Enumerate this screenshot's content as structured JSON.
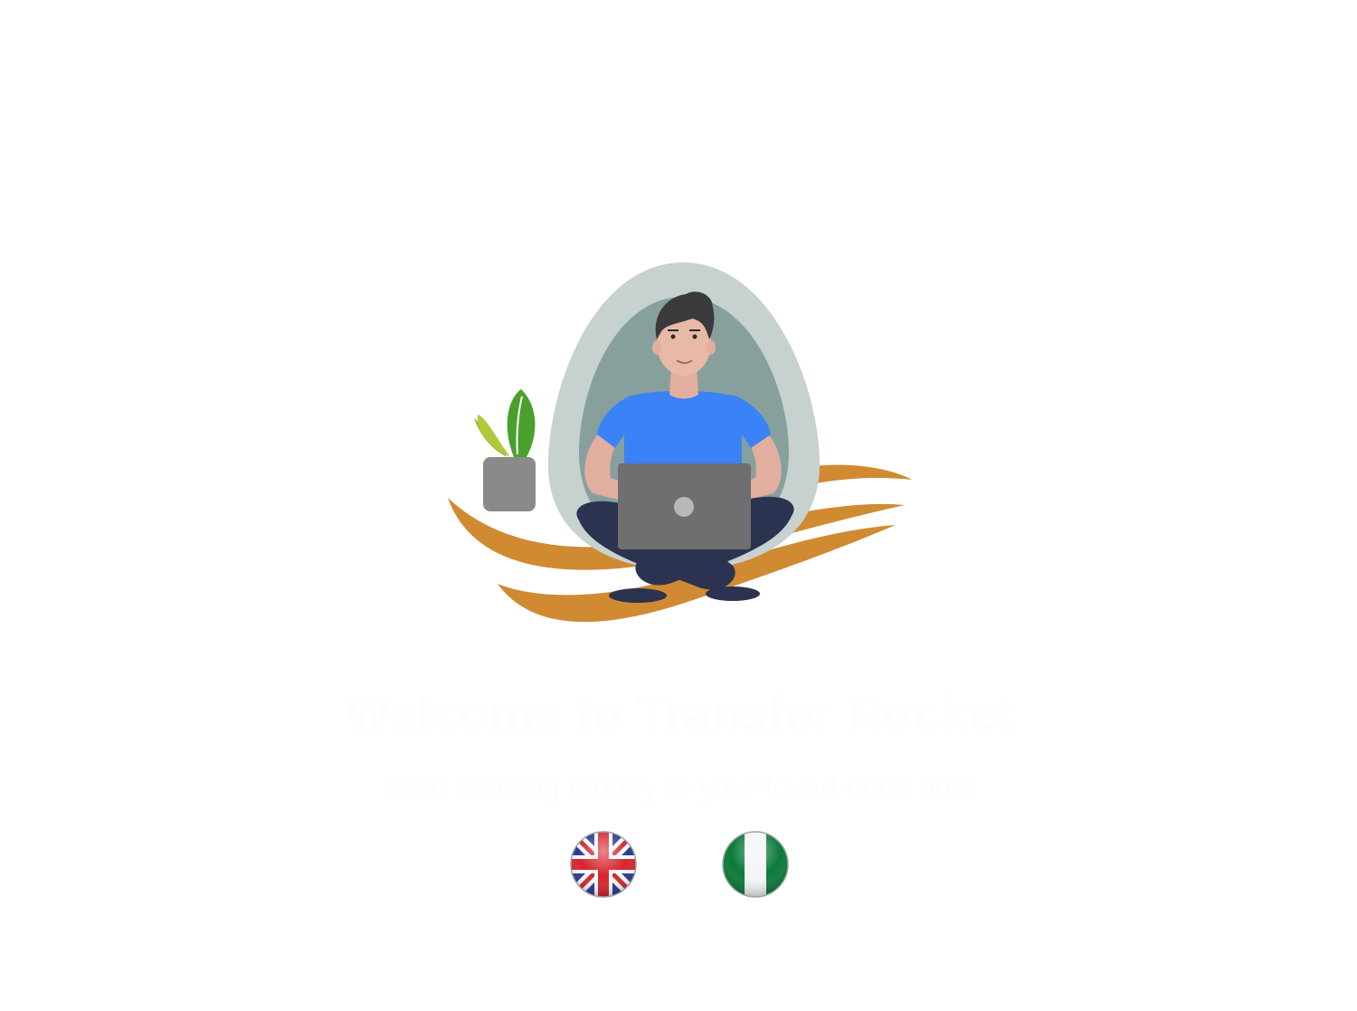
{
  "hero": {
    "illustration": "person-with-laptop-illustration"
  },
  "welcome": {
    "title": "Welcome to Transfer Rocket",
    "subtitle": "Start sending money to your loved ones now"
  },
  "flags": [
    {
      "icon": "uk-flag-icon"
    },
    {
      "icon": "nigeria-flag-icon"
    }
  ],
  "colors": {
    "background": "#ffffff",
    "accent_orange": "#d08a32",
    "shirt_blue": "#3b82f6",
    "pants_navy": "#2c3350",
    "text_faint": "#fdfdfd"
  }
}
